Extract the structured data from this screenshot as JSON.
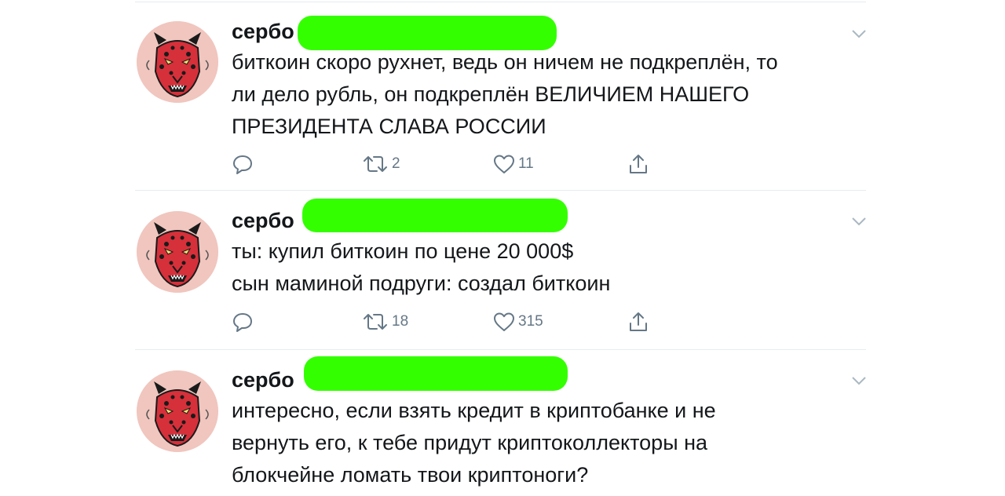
{
  "tweets": [
    {
      "author": "сербо",
      "text": "биткоин скоро рухнет, ведь он ничем не подкреплён, то\nли дело рубль, он подкреплён ВЕЛИЧИЕМ НАШЕГО\nПРЕЗИДЕНТА СЛАВА РОССИИ",
      "retweets": "2",
      "likes": "11"
    },
    {
      "author": "сербо",
      "text": "ты: купил биткоин по цене 20 000$\nсын маминой подруги: создал биткоин",
      "retweets": "18",
      "likes": "315"
    },
    {
      "author": "сербо",
      "text": "интересно, если взять кредит в криптобанке и не\nвернуть его, к тебе придут криптоколлекторы на\nблокчейне ломать твои криптоноги?"
    }
  ],
  "icons": {
    "reply": "reply-icon",
    "retweet": "retweet-icon",
    "like": "heart-icon",
    "share": "share-icon",
    "menu": "chevron-down-icon"
  },
  "colors": {
    "redaction": "#33ff00",
    "avatar_bg": "#f0c6bf",
    "icon": "#657786",
    "divider": "#e6ecf0"
  }
}
